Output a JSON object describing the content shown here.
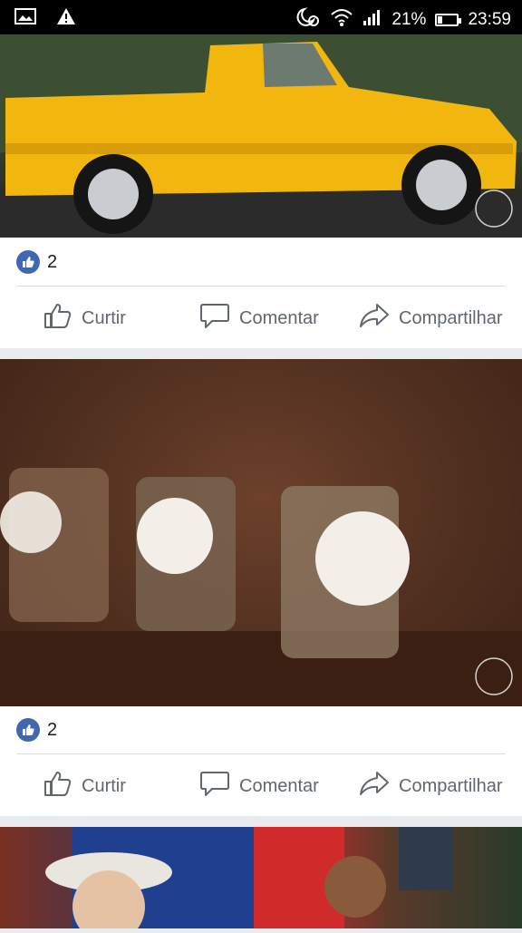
{
  "status_bar": {
    "battery_percent": "21%",
    "time": "23:59",
    "battery_level": 0.21,
    "icons": [
      "gallery-icon",
      "warning-icon",
      "alarm-moon-icon",
      "wifi-icon",
      "signal-icon",
      "battery-icon"
    ]
  },
  "posts": [
    {
      "image_icon": "yellow-truck-photo",
      "likes_count": "2",
      "actions": {
        "like": "Curtir",
        "comment": "Comentar",
        "share": "Compartilhar"
      }
    },
    {
      "image_icon": "jars-favors-photo",
      "likes_count": "2",
      "actions": {
        "like": "Curtir",
        "comment": "Comentar",
        "share": "Compartilhar"
      }
    },
    {
      "image_icon": "children-wedding-photo"
    }
  ],
  "colors": {
    "facebook_blue": "#4267b2",
    "action_gray": "#606770",
    "truck_yellow": "#f2b70f",
    "feed_background": "#e9ebee"
  }
}
